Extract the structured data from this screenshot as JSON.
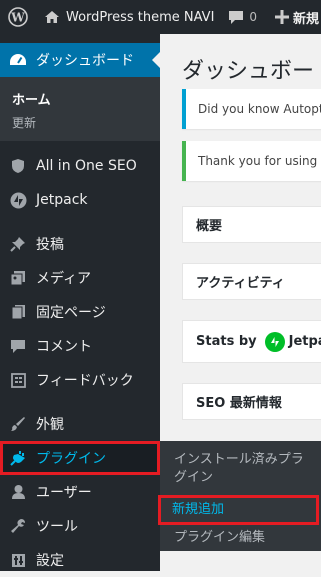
{
  "admin_bar": {
    "site_name": "WordPress theme NAVI",
    "comment_count": "0",
    "new_label": "新規"
  },
  "sidebar": {
    "dashboard": "ダッシュボード",
    "dashboard_submenu": [
      "ホーム",
      "更新"
    ],
    "items": [
      {
        "label": "All in One SEO",
        "icon": "shield-icon"
      },
      {
        "label": "Jetpack",
        "icon": "jetpack-icon"
      },
      {
        "label": "投稿",
        "icon": "pin-icon"
      },
      {
        "label": "メディア",
        "icon": "media-icon"
      },
      {
        "label": "固定ページ",
        "icon": "pages-icon"
      },
      {
        "label": "コメント",
        "icon": "comment-icon"
      },
      {
        "label": "フィードバック",
        "icon": "feedback-icon"
      },
      {
        "label": "外観",
        "icon": "brush-icon"
      },
      {
        "label": "プラグイン",
        "icon": "plugin-icon"
      },
      {
        "label": "ユーザー",
        "icon": "user-icon"
      },
      {
        "label": "ツール",
        "icon": "wrench-icon"
      },
      {
        "label": "設定",
        "icon": "settings-icon"
      }
    ]
  },
  "flyout": {
    "installed": "インストール済みプラグイン",
    "add_new": "新規追加",
    "editor": "プラグイン編集"
  },
  "main": {
    "title": "ダッシュボー",
    "notices": [
      "Did you know Autopt",
      "Thank you for using"
    ],
    "boxes": [
      "概要",
      "アクティビティ",
      "Stats by",
      "SEO 最新情報"
    ],
    "jetpack_text": "Jetpack"
  },
  "colors": {
    "admin_bar_bg": "#23282d",
    "menu_current": "#0073aa",
    "highlight_red": "#e51c23",
    "link_blue": "#00b9eb",
    "jetpack_green": "#00be28"
  }
}
